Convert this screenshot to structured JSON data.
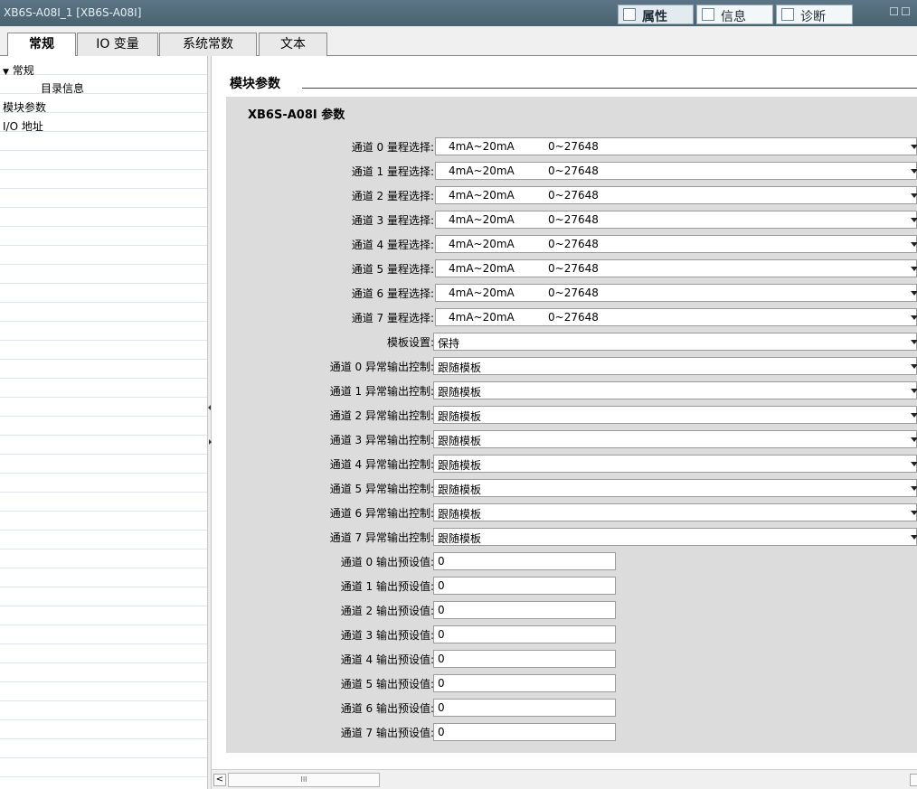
{
  "window": {
    "title": "XB6S-A08I_1 [XB6S-A08I]",
    "tabs": [
      {
        "label": "属性",
        "icon": "properties-icon"
      },
      {
        "label": "信息",
        "icon": "info-icon"
      },
      {
        "label": "诊断",
        "icon": "diagnostics-icon"
      }
    ]
  },
  "tabs": [
    {
      "label": "常规"
    },
    {
      "label": "IO 变量"
    },
    {
      "label": "系统常数"
    },
    {
      "label": "文本"
    }
  ],
  "nav": {
    "group": "常规",
    "items": [
      {
        "label": "目录信息"
      },
      {
        "label": "模块参数"
      },
      {
        "label": "I/O 地址"
      }
    ]
  },
  "main": {
    "section_title": "模块参数",
    "subtitle": "XB6S-A08I 参数",
    "range_rows": [
      {
        "label": "通道 0 量程选择:",
        "value": "4mA~20mA",
        "range": "0~27648"
      },
      {
        "label": "通道 1 量程选择:",
        "value": "4mA~20mA",
        "range": "0~27648"
      },
      {
        "label": "通道 2 量程选择:",
        "value": "4mA~20mA",
        "range": "0~27648"
      },
      {
        "label": "通道 3 量程选择:",
        "value": "4mA~20mA",
        "range": "0~27648"
      },
      {
        "label": "通道 4 量程选择:",
        "value": "4mA~20mA",
        "range": "0~27648"
      },
      {
        "label": "通道 5 量程选择:",
        "value": "4mA~20mA",
        "range": "0~27648"
      },
      {
        "label": "通道 6 量程选择:",
        "value": "4mA~20mA",
        "range": "0~27648"
      },
      {
        "label": "通道 7 量程选择:",
        "value": "4mA~20mA",
        "range": "0~27648"
      }
    ],
    "template_row": {
      "label": "模板设置:",
      "value": "保持"
    },
    "fault_rows": [
      {
        "label": "通道 0 异常输出控制:",
        "value": "跟随模板"
      },
      {
        "label": "通道 1 异常输出控制:",
        "value": "跟随模板"
      },
      {
        "label": "通道 2 异常输出控制:",
        "value": "跟随模板"
      },
      {
        "label": "通道 3 异常输出控制:",
        "value": "跟随模板"
      },
      {
        "label": "通道 4 异常输出控制:",
        "value": "跟随模板"
      },
      {
        "label": "通道 5 异常输出控制:",
        "value": "跟随模板"
      },
      {
        "label": "通道 6 异常输出控制:",
        "value": "跟随模板"
      },
      {
        "label": "通道 7 异常输出控制:",
        "value": "跟随模板"
      }
    ],
    "preset_rows": [
      {
        "label": "通道 0 输出预设值:",
        "value": "0"
      },
      {
        "label": "通道 1 输出预设值:",
        "value": "0"
      },
      {
        "label": "通道 2 输出预设值:",
        "value": "0"
      },
      {
        "label": "通道 3 输出预设值:",
        "value": "0"
      },
      {
        "label": "通道 4 输出预设值:",
        "value": "0"
      },
      {
        "label": "通道 5 输出预设值:",
        "value": "0"
      },
      {
        "label": "通道 6 输出预设值:",
        "value": "0"
      },
      {
        "label": "通道 7 输出预设值:",
        "value": "0"
      }
    ]
  },
  "scrollbar": {
    "left_arrow": "<",
    "thumb_grip": "III"
  }
}
